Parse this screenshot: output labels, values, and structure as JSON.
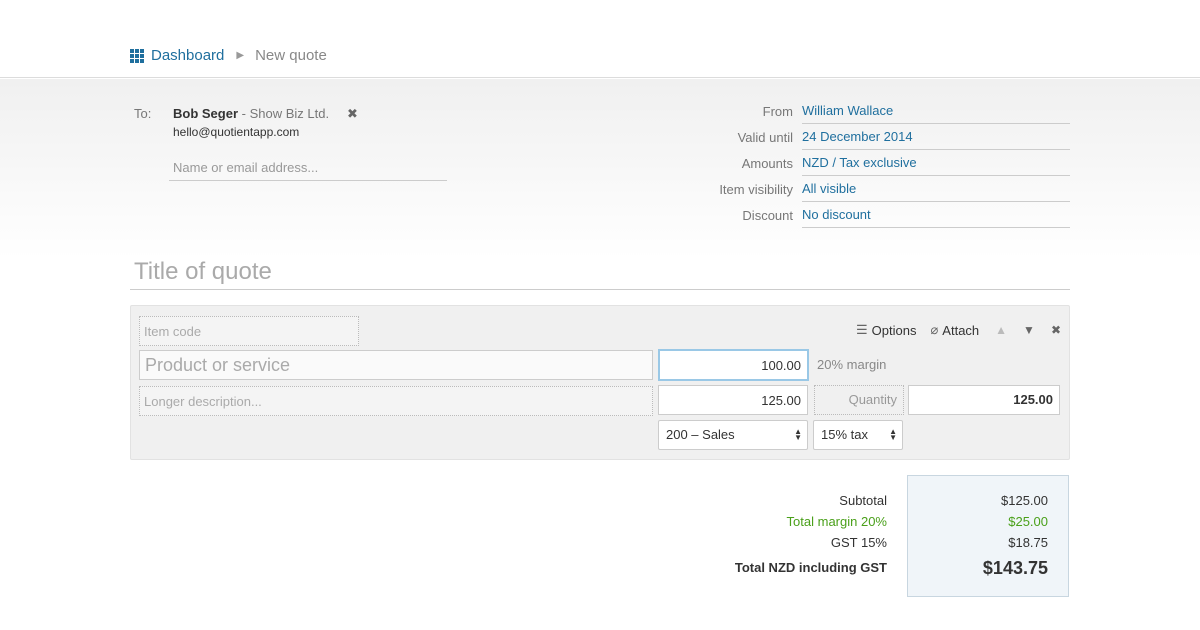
{
  "breadcrumb": {
    "dashboard": "Dashboard",
    "current": "New quote"
  },
  "to": {
    "label": "To:",
    "name": "Bob Seger",
    "separator": " - ",
    "company": "Show Biz Ltd.",
    "email": "hello@quotientapp.com",
    "input_placeholder": "Name or email address...",
    "remove_icon": "close-icon"
  },
  "meta": [
    {
      "label": "From",
      "value": "William Wallace"
    },
    {
      "label": "Valid until",
      "value": "24 December 2014"
    },
    {
      "label": "Amounts",
      "value": "NZD / Tax exclusive"
    },
    {
      "label": "Item visibility",
      "value": "All visible"
    },
    {
      "label": "Discount",
      "value": "No discount"
    }
  ],
  "title_placeholder": "Title of quote",
  "item": {
    "code_placeholder": "Item code",
    "product_placeholder": "Product or service",
    "cost": "100.00",
    "margin": "20% margin",
    "description_placeholder": "Longer description...",
    "price": "125.00",
    "quantity_label": "Quantity",
    "total": "125.00",
    "account": "200 – Sales",
    "tax": "15% tax",
    "options_label": "Options",
    "attach_label": "Attach"
  },
  "totals": {
    "subtotal_label": "Subtotal",
    "subtotal": "$125.00",
    "margin_label": "Total margin 20%",
    "margin": "$25.00",
    "gst_label": "GST 15%",
    "gst": "$18.75",
    "total_label": "Total NZD including GST",
    "total": "$143.75"
  },
  "colors": {
    "link": "#1f6f9e",
    "margin_green": "#4aa01a",
    "focus_border": "#9ac8e6"
  }
}
